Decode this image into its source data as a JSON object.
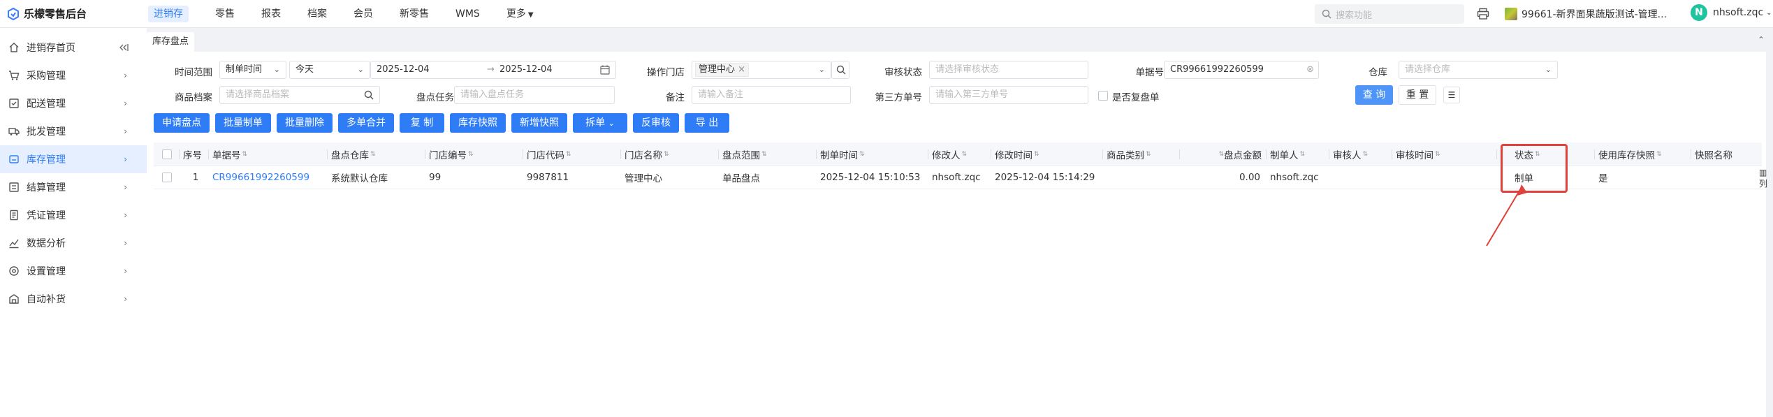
{
  "app": {
    "title": "乐檬零售后台"
  },
  "topnav": [
    {
      "label": "进销存",
      "active": true
    },
    {
      "label": "零售"
    },
    {
      "label": "报表"
    },
    {
      "label": "档案"
    },
    {
      "label": "会员"
    },
    {
      "label": "新零售"
    },
    {
      "label": "WMS"
    },
    {
      "label": "更多"
    }
  ],
  "header": {
    "search_placeholder": "搜索功能",
    "store": "99661-新界面果蔬版测试-管理...",
    "avatar_letter": "N",
    "username": "nhsoft.zqc"
  },
  "sidebar": {
    "items": [
      {
        "label": "进销存首页"
      },
      {
        "label": "采购管理"
      },
      {
        "label": "配送管理"
      },
      {
        "label": "批发管理"
      },
      {
        "label": "库存管理",
        "active": true
      },
      {
        "label": "结算管理"
      },
      {
        "label": "凭证管理"
      },
      {
        "label": "数据分析"
      },
      {
        "label": "设置管理"
      },
      {
        "label": "自动补货"
      }
    ]
  },
  "tab": {
    "label": "库存盘点"
  },
  "filters": {
    "time_range_label": "时间范围",
    "time_type": "制单时间",
    "period": "今天",
    "date_from": "2025-12-04",
    "date_sep": "→",
    "date_to": "2025-12-04",
    "store_label": "操作门店",
    "store_tag": "管理中心",
    "audit_label": "审核状态",
    "audit_placeholder": "请选择审核状态",
    "docno_label": "单据号",
    "docno_value": "CR99661992260599",
    "warehouse_label": "仓库",
    "warehouse_placeholder": "请选择仓库",
    "product_label": "商品档案",
    "product_placeholder": "请选择商品档案",
    "task_label": "盘点任务",
    "task_placeholder": "请输入盘点任务",
    "remark_label": "备注",
    "remark_placeholder": "请输入备注",
    "third_label": "第三方单号",
    "third_placeholder": "请输入第三方单号",
    "recheck_label": "是否复盘单",
    "query_button": "查 询",
    "reset_button": "重 置"
  },
  "toolbar": [
    "申请盘点",
    "批量制单",
    "批量删除",
    "多单合并",
    "复 制",
    "库存快照",
    "新增快照",
    "拆单",
    "反审核",
    "导 出"
  ],
  "table": {
    "columns": [
      "序号",
      "单据号",
      "盘点仓库",
      "门店编号",
      "门店代码",
      "门店名称",
      "盘点范围",
      "制单时间",
      "修改人",
      "修改时间",
      "商品类别",
      "盘点金额",
      "制单人",
      "审核人",
      "审核时间",
      "状态",
      "使用库存快照",
      "快照名称"
    ],
    "rows": [
      {
        "no": "1",
        "docno": "CR99661992260599",
        "warehouse": "系统默认仓库",
        "store_no": "99",
        "store_code": "9987811",
        "store_name": "管理中心",
        "scope": "单品盘点",
        "created": "2025-12-04 15:10:53",
        "modifier": "nhsoft.zqc",
        "modified": "2025-12-04 15:14:29",
        "category": "",
        "amount": "0.00",
        "creator": "nhsoft.zqc",
        "auditor": "",
        "audit_time": "",
        "status": "制单",
        "use_snapshot": "是",
        "snapshot_name": ""
      }
    ]
  },
  "side_tools": {
    "columns_label": "列"
  },
  "colors": {
    "accent": "#2f7df6",
    "highlight": "#e0413a",
    "sidebar_active_bg": "#e6efff"
  }
}
